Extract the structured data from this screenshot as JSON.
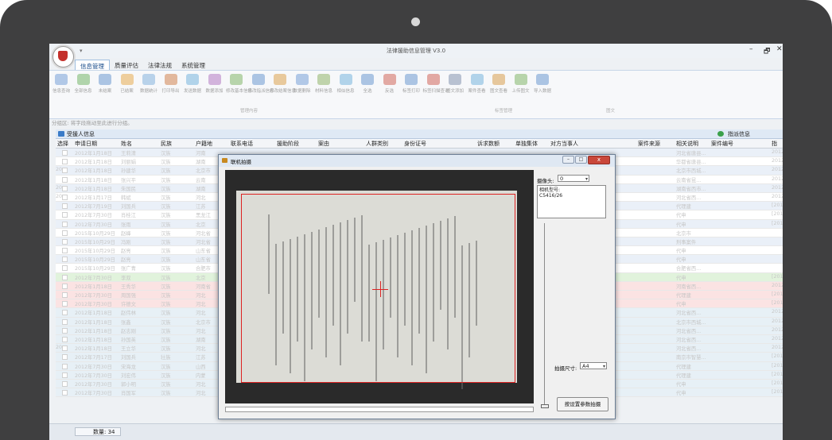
{
  "app": {
    "title": "法律援助信息管理 V3.0",
    "quick_access": "▾",
    "win_minimize": "–",
    "win_restore": "🗗",
    "win_close": "✕"
  },
  "menu": {
    "tabs": [
      "信息管理",
      "质量评估",
      "法律法规",
      "系统管理"
    ]
  },
  "ribbon": {
    "items": [
      "信息查询",
      "全部信息",
      "未结案",
      "已结案",
      "数据统计",
      "打印导出",
      "发送数据",
      "数据添加",
      "修改基本信息",
      "修改指派信息",
      "修改结案信息",
      "数据删除",
      "材料信息",
      "相似信息",
      "全选",
      "反选",
      "标签打印",
      "标签扫描查询",
      "图文添加",
      "案件查看",
      "图文查看",
      "上传图文",
      "导入数据"
    ],
    "groups": [
      "管理内容",
      "标签管理",
      "图文"
    ]
  },
  "group_hint": "分组区: 将字段拖动至此进行分组。",
  "grid": {
    "title": "受援人信息",
    "title_right": "指派信息",
    "columns": [
      "选择",
      "申请日期",
      "姓名",
      "民族",
      "户籍地",
      "联系电话",
      "援助阶段",
      "案由",
      "人群类别",
      "身份证号",
      "诉求数额",
      "单独集体",
      "对方当事人",
      "案件来源",
      "相关说明",
      "案件编号",
      "指"
    ],
    "rows": [
      [
        "2012年1月18日",
        "王莉清",
        "汉族",
        "河南",
        "",
        "",
        "",
        "",
        "",
        "",
        "",
        "",
        "",
        "河北省唐县...",
        "",
        "2012[30]",
        ""
      ],
      [
        "2012年1月18日",
        "刘丽娟",
        "汉族",
        "湖南",
        "",
        "",
        "",
        "",
        "",
        "",
        "",
        "",
        "",
        "华都省唐县...",
        "",
        "2012[31]",
        ""
      ],
      [
        "2012年1月18日",
        "孙建华",
        "汉族",
        "北京市",
        "",
        "",
        "",
        "",
        "",
        "",
        "",
        "",
        "",
        "北京市西城...",
        "",
        "2012[31]",
        "20"
      ],
      [
        "2012年1月18日",
        "张兴平",
        "汉族",
        "云南",
        "",
        "",
        "",
        "",
        "",
        "",
        "",
        "",
        "",
        "云南省昆...",
        "",
        "2012[35]",
        ""
      ],
      [
        "2012年1月18日",
        "朱国民",
        "汉族",
        "湖南",
        "",
        "",
        "",
        "",
        "",
        "",
        "",
        "",
        "",
        "湖南省西市...",
        "",
        "2012[40]",
        "20"
      ],
      [
        "2012年1月17日",
        "韩斌",
        "汉族",
        "河北",
        "",
        "",
        "",
        "",
        "",
        "",
        "",
        "",
        "",
        "河北省西...",
        "",
        "2012[51]",
        "20"
      ],
      [
        "2012年7月19日",
        "刘国兵",
        "汉族",
        "江苏",
        "",
        "",
        "",
        "",
        "",
        "",
        "",
        "",
        "",
        "代理建",
        "",
        "[2012]454",
        ""
      ],
      [
        "2012年7月30日",
        "肖桂江",
        "汉族",
        "黑龙江",
        "",
        "",
        "",
        "",
        "",
        "",
        "",
        "",
        "",
        "代申",
        "",
        "[2012]485",
        ""
      ],
      [
        "2012年7月30日",
        "张雨",
        "汉族",
        "北京",
        "",
        "",
        "",
        "",
        "",
        "",
        "",
        "",
        "",
        "代申",
        "",
        "[2012]486",
        ""
      ],
      [
        "2015年10月29日",
        "赵峰",
        "汉族",
        "河北省",
        "",
        "",
        "",
        "",
        "",
        "",
        "",
        "",
        "",
        "北京市",
        "",
        "",
        ""
      ],
      [
        "2015年10月29日",
        "冯刚",
        "汉族",
        "河北省",
        "",
        "",
        "",
        "",
        "",
        "",
        "",
        "",
        "",
        "刑事案件",
        "",
        "",
        ""
      ],
      [
        "2015年10月29日",
        "赵亮",
        "汉族",
        "山东省",
        "",
        "",
        "",
        "",
        "",
        "",
        "",
        "",
        "",
        "代申",
        "",
        "",
        ""
      ],
      [
        "2015年10月29日",
        "赵亮",
        "汉族",
        "山东省",
        "",
        "",
        "",
        "",
        "",
        "",
        "",
        "",
        "",
        "代申",
        "",
        "",
        ""
      ],
      [
        "2015年10月29日",
        "张广青",
        "汉族",
        "合肥市",
        "",
        "",
        "",
        "",
        "",
        "",
        "",
        "",
        "",
        "合肥省西...",
        "",
        "",
        ""
      ],
      [
        "2012年7月30日",
        "李双",
        "汉族",
        "北京",
        "",
        "",
        "",
        "",
        "",
        "",
        "",
        "",
        "",
        "代申",
        "",
        "[2012]487",
        ""
      ],
      [
        "2012年1月18日",
        "王秀华",
        "汉族",
        "河南省",
        "",
        "",
        "",
        "",
        "",
        "",
        "",
        "",
        "",
        "河南省西...",
        "",
        "2012[28]",
        ""
      ],
      [
        "2012年7月30日",
        "周国强",
        "汉族",
        "河北",
        "",
        "",
        "",
        "",
        "",
        "",
        "",
        "",
        "",
        "代理建",
        "",
        "[2012]457",
        ""
      ],
      [
        "2012年7月30日",
        "许德文",
        "汉族",
        "河北",
        "",
        "",
        "",
        "",
        "",
        "",
        "",
        "",
        "",
        "代申",
        "",
        "[2012]488",
        ""
      ],
      [
        "2012年1月18日",
        "赵伟林",
        "汉族",
        "河北",
        "",
        "",
        "",
        "",
        "",
        "",
        "",
        "",
        "",
        "河北省西...",
        "",
        "2012[33]",
        ""
      ],
      [
        "2012年1月18日",
        "张鑫",
        "汉族",
        "北京市",
        "",
        "",
        "",
        "",
        "",
        "",
        "",
        "",
        "",
        "北京市西城...",
        "",
        "2012[36]",
        ""
      ],
      [
        "2012年1月18日",
        "赵志刚",
        "汉族",
        "河北",
        "",
        "",
        "",
        "",
        "",
        "",
        "",
        "",
        "",
        "河北省西...",
        "",
        "2012[37]",
        ""
      ],
      [
        "2012年1月18日",
        "孙国英",
        "汉族",
        "湖南",
        "",
        "",
        "",
        "",
        "",
        "",
        "",
        "",
        "",
        "河北省西...",
        "",
        "2012[38]",
        ""
      ],
      [
        "2012年1月18日",
        "王立华",
        "汉族",
        "河北",
        "",
        "",
        "",
        "",
        "",
        "",
        "",
        "",
        "",
        "河北省西...",
        "",
        "2012[39]",
        "20"
      ],
      [
        "2012年7月17日",
        "刘国兵",
        "壮族",
        "江苏",
        "",
        "",
        "",
        "",
        "",
        "",
        "",
        "",
        "",
        "南京市智慧...",
        "",
        "[2012]476",
        ""
      ],
      [
        "2012年7月30日",
        "宋海龙",
        "汉族",
        "山西",
        "",
        "",
        "",
        "",
        "",
        "",
        "",
        "",
        "",
        "代理建",
        "",
        "[2012]452",
        ""
      ],
      [
        "2012年7月30日",
        "刘宏伟",
        "汉族",
        "内蒙",
        "",
        "",
        "",
        "",
        "",
        "",
        "",
        "",
        "",
        "代理建",
        "",
        "[2012]456",
        ""
      ],
      [
        "2012年7月30日",
        "郭小明",
        "汉族",
        "河北",
        "",
        "",
        "",
        "",
        "",
        "",
        "",
        "",
        "",
        "代申",
        "",
        "[2012]488",
        ""
      ],
      [
        "2012年7月30日",
        "肖国军",
        "汉族",
        "河北",
        "",
        "",
        "",
        "",
        "",
        "",
        "",
        "",
        "",
        "代申",
        "",
        "[2012]489",
        ""
      ]
    ],
    "row_colors": [
      "#eaf0f8",
      "#ffffff",
      "#eaf0f8",
      "#ffffff",
      "#eaf0f8",
      "#ffffff",
      "#eaf0f8",
      "#ffffff",
      "#eaf0f8",
      "#ffffff",
      "#eaf0f8",
      "#ffffff",
      "#eaf0f8",
      "#ffffff",
      "#e1f3dc",
      "#fbe3e3",
      "#fbe3e3",
      "#fbe3e3",
      "#e7f0f6",
      "#e7f0f6",
      "#e7f0f6",
      "#e7f0f6",
      "#e7f0f6",
      "#e7f0f6",
      "#e7f0f6",
      "#e7f0f6",
      "#e7f0f6",
      "#e7f0f6"
    ]
  },
  "status": {
    "count_label": "数量: 34"
  },
  "dialog": {
    "title": "联机拍摄",
    "camera_label": "摄像头:",
    "camera_value": "0",
    "info_text": "相机型号:\nC5416/26",
    "size_label": "拍摄尺寸:",
    "size_value": "A4",
    "shoot_button": "按设置参数拍摄",
    "btn_min": "–",
    "btn_max": "□",
    "btn_close": "x"
  },
  "colors": {
    "accent": "#1a4c8b",
    "highlight_red": "#d22222",
    "dialog_frame": "#6d7f95"
  }
}
